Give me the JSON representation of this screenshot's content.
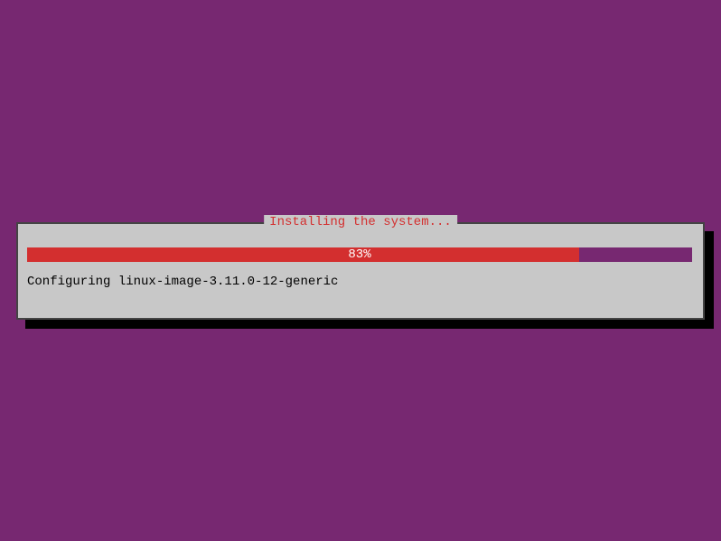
{
  "dialog": {
    "title": "Installing the system...",
    "progress_percent": 83,
    "progress_label": "83%",
    "status": "Configuring linux-image-3.11.0-12-generic"
  },
  "colors": {
    "background": "#772871",
    "dialog_bg": "#c8c8c8",
    "accent_red": "#d32f2f",
    "progress_bg": "#772871"
  }
}
